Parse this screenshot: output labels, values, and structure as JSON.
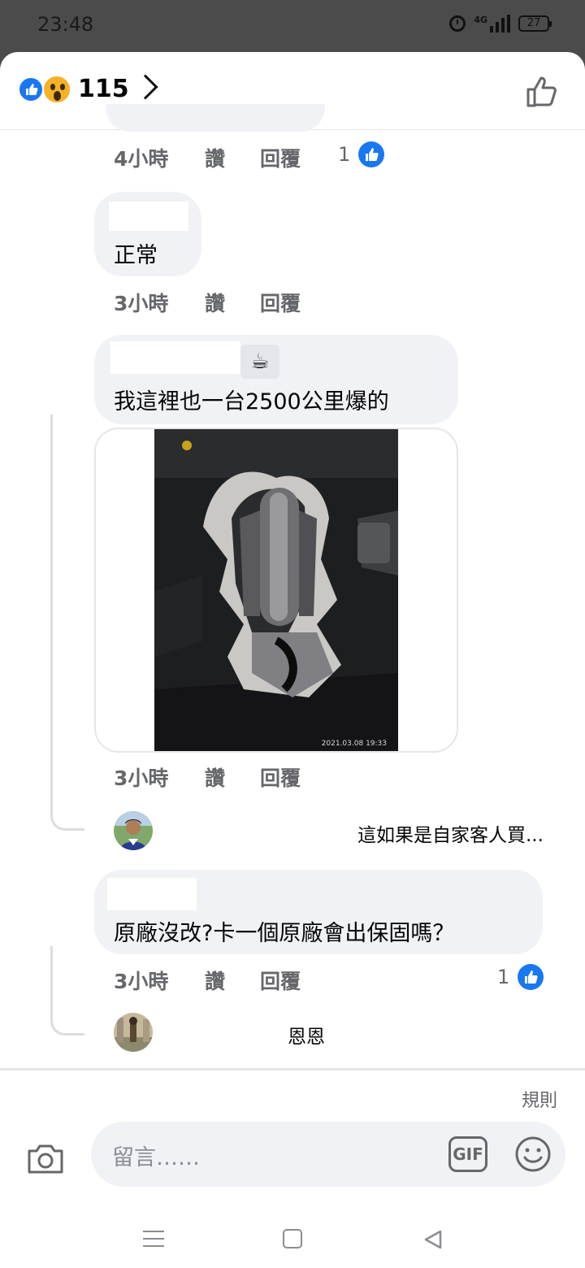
{
  "status_bar": {
    "time": "23:48",
    "network_label": "4G",
    "battery": "27"
  },
  "header": {
    "reaction_count": "115",
    "reactions": [
      "like-icon",
      "wow-icon"
    ]
  },
  "comments": [
    {
      "id": "c0",
      "time": "4小時",
      "like_label": "讚",
      "reply_label": "回覆",
      "like_count": "1"
    },
    {
      "id": "c1",
      "text": "正常",
      "time": "3小時",
      "like_label": "讚",
      "reply_label": "回覆"
    },
    {
      "id": "c2",
      "text": "我這裡也一台2500公里爆的",
      "name_emoji": "☕",
      "photo_timestamp": "2021.03.08 19:33",
      "time": "3小時",
      "like_label": "讚",
      "reply_label": "回覆",
      "reply_preview": "這如果是自家客人買..."
    },
    {
      "id": "c3",
      "text": "原廠沒改?卡一個原廠會出保固嗎？",
      "time": "3小時",
      "like_label": "讚",
      "reply_label": "回覆",
      "like_count": "1",
      "reply_preview": "恩恩"
    }
  ],
  "composer": {
    "rules_label": "規則",
    "placeholder": "留言……",
    "gif_label": "GIF"
  },
  "colors": {
    "accent": "#1877f2",
    "bubble": "#f0f2f5",
    "meta_text": "#65676b"
  }
}
